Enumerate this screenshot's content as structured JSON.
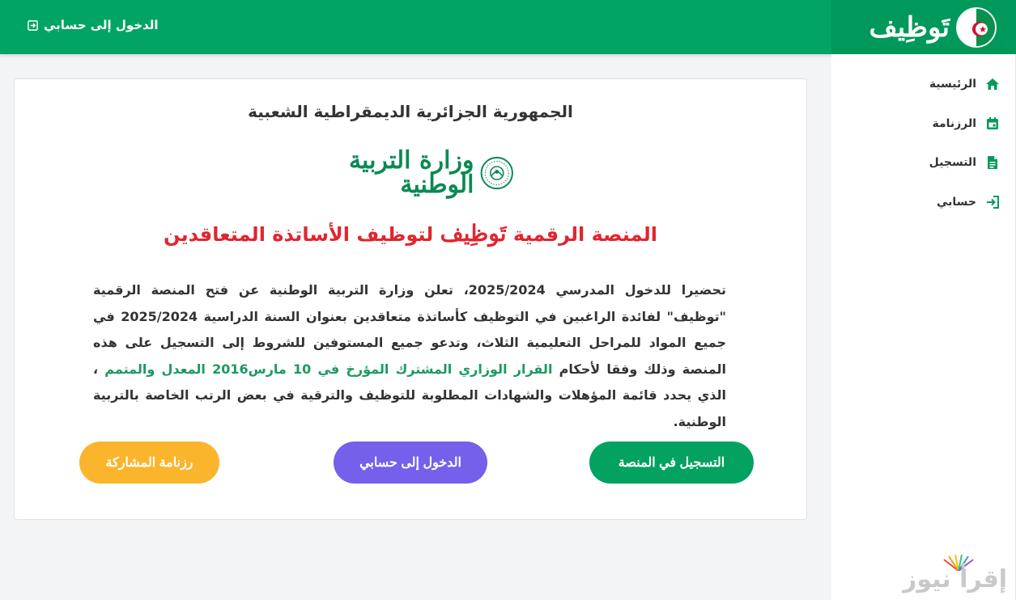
{
  "header": {
    "brand_logo": "تَوظِيف",
    "login_label": "الدخول إلى حسابي"
  },
  "sidebar": {
    "items": [
      {
        "label": "الرئيسية",
        "icon": "home-icon"
      },
      {
        "label": "الرزنامة",
        "icon": "calendar-icon"
      },
      {
        "label": "التسجيل",
        "icon": "document-icon"
      },
      {
        "label": "حسابي",
        "icon": "sign-in-icon"
      }
    ]
  },
  "card": {
    "republic": "الجمهورية الجزائرية الديمقراطية الشعبية",
    "ministry": "وزارة التربية الوطنية",
    "headline_start": "المنصة الرقمية ",
    "headline_logo": "تَوظِيف",
    "headline_end": " لتوظيف الأساتذة المتعاقدين",
    "desc_part1": "تحضيرا للدخول المدرسي 2025/2024، تعلن وزارة التربية الوطنية عن فتح المنصة الرقمية \"توظيف\" لفائدة الراغبين في التوظيف كأساتذة متعاقدين بعنوان السنة الدراسية 2025/2024 في جميع المواد للمراحل التعليمية الثلاث، وتدعو جميع المستوفين للشروط إلى التسجيل على هذه المنصة وذلك وفقا لأحكام ",
    "desc_link": "القرار الوزاري المشترك المؤرخ في 10 مارس2016 المعدل والمتمم",
    "desc_part2": " ، الذي يحدد قائمة المؤهلات والشهادات المطلوبة للتوظيف والترقية في بعض الرتب الخاصة بالتربية الوطنية."
  },
  "buttons": {
    "register": "التسجيل في المنصة",
    "login": "الدخول إلى حسابي",
    "calendar": "رزنامة المشاركة"
  },
  "watermark": "إقرأ نيوز",
  "colors": {
    "header": "#02a463",
    "brand_bg": "#01985b",
    "headline": "#e0262f",
    "link": "#1a9a5f",
    "btn_register": "#03a261",
    "btn_login": "#7560ec",
    "btn_calendar": "#fbb52c"
  }
}
